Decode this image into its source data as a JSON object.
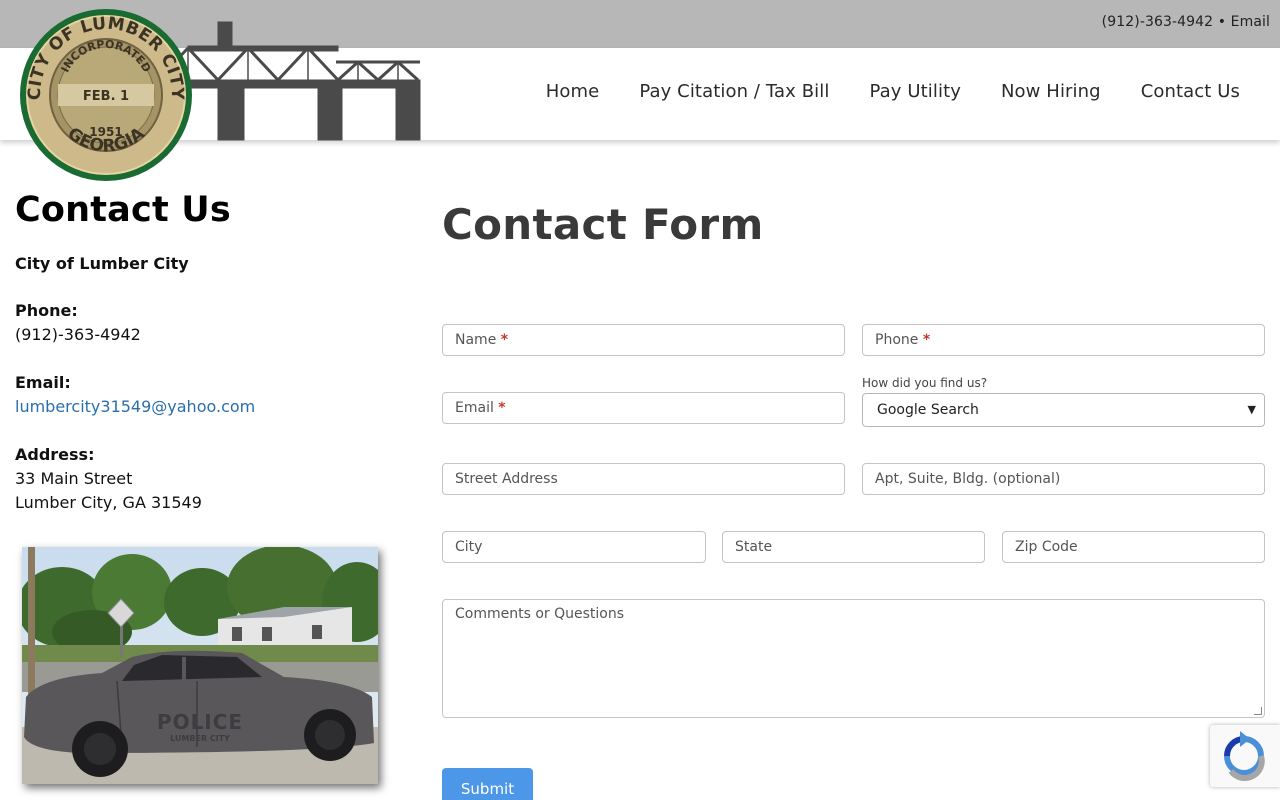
{
  "topbar": {
    "phone": "(912)-363-4942",
    "separator": "•",
    "email_label": "Email"
  },
  "logo": {
    "seal_text_top": "CITY OF LUMBER CITY",
    "seal_inner_top": "INCORPORATED",
    "seal_center": "FEB. 1",
    "seal_year": "1951",
    "seal_bottom": "GEORGIA"
  },
  "nav": {
    "items": [
      {
        "label": "Home"
      },
      {
        "label": "Pay Citation / Tax Bill"
      },
      {
        "label": "Pay Utility"
      },
      {
        "label": "Now Hiring"
      },
      {
        "label": "Contact Us"
      }
    ]
  },
  "contact": {
    "heading": "Contact Us",
    "org": "City of Lumber City",
    "phone_label": "Phone:",
    "phone": "(912)-363-4942",
    "email_label": "Email:",
    "email": "lumbercity31549@yahoo.com",
    "address_label": "Address:",
    "address_line1": "33 Main Street",
    "address_line2": "Lumber City, GA 31549"
  },
  "photo": {
    "car_text": "POLICE",
    "car_subtext": "LUMBER CITY"
  },
  "form": {
    "title": "Contact Form",
    "name_placeholder": "Name",
    "phone_placeholder": "Phone",
    "required_mark": "*",
    "email_placeholder": "Email",
    "find_label": "How did you find us?",
    "find_selected": "Google Search",
    "street_placeholder": "Street Address",
    "apt_placeholder": "Apt, Suite, Bldg. (optional)",
    "city_placeholder": "City",
    "state_placeholder": "State",
    "zip_placeholder": "Zip Code",
    "comments_placeholder": "Comments or Questions",
    "submit_label": "Submit"
  },
  "colors": {
    "link": "#2a6fad",
    "submit": "#4d97e8",
    "required": "#c0392b",
    "seal_green": "#1a6b32"
  }
}
